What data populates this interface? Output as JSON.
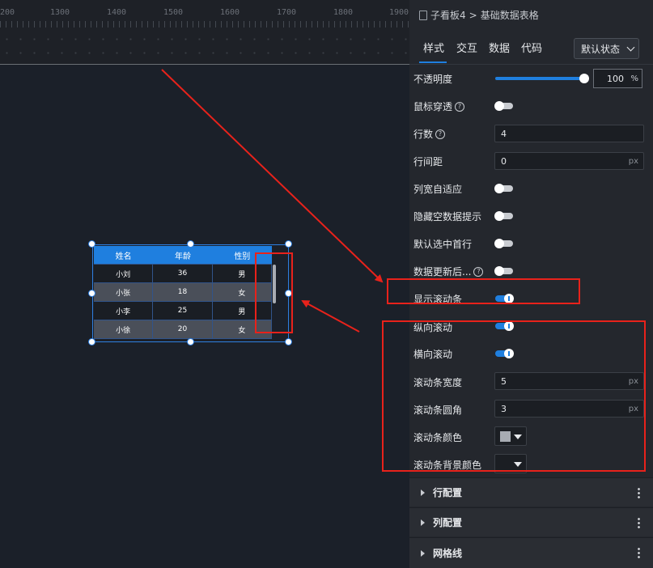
{
  "ruler": {
    "ticks": [
      "200",
      "1300",
      "1400",
      "1500",
      "1600",
      "1700",
      "1800",
      "1900"
    ]
  },
  "table": {
    "headers": [
      "姓名",
      "年龄",
      "性别"
    ],
    "rows": [
      [
        "小刘",
        "36",
        "男"
      ],
      [
        "小张",
        "18",
        "女"
      ],
      [
        "小李",
        "25",
        "男"
      ],
      [
        "小徐",
        "20",
        "女"
      ]
    ]
  },
  "panel": {
    "breadcrumb": {
      "parent": "子看板4",
      "sep": ">",
      "current": "基础数据表格"
    },
    "tabs": [
      "样式",
      "交互",
      "数据",
      "代码"
    ],
    "state_select": "默认状态",
    "props": {
      "opacity_label": "不透明度",
      "opacity_value": "100",
      "opacity_unit": "%",
      "opacity_fraction": 1.0,
      "mouse_through": "鼠标穿透",
      "rows_label": "行数",
      "rows_value": "4",
      "row_gap_label": "行间距",
      "row_gap_value": "0",
      "row_gap_unit": "px",
      "col_auto": "列宽自适应",
      "hide_empty": "隐藏空数据提示",
      "select_first": "默认选中首行",
      "data_update": "数据更新后...",
      "show_scroll": "显示滚动条",
      "v_scroll": "纵向滚动",
      "h_scroll": "横向滚动",
      "scroll_width_label": "滚动条宽度",
      "scroll_width_value": "5",
      "scroll_width_unit": "px",
      "scroll_radius_label": "滚动条圆角",
      "scroll_radius_value": "3",
      "scroll_radius_unit": "px",
      "scroll_color_label": "滚动条颜色",
      "scroll_bg_label": "滚动条背景颜色",
      "help_glyph": "?"
    },
    "sections": [
      "行配置",
      "列配置",
      "网格线"
    ]
  },
  "colors": {
    "accent": "#1f7fdf",
    "annotation": "#e8221b",
    "scroll_color": "#a8acb3"
  }
}
